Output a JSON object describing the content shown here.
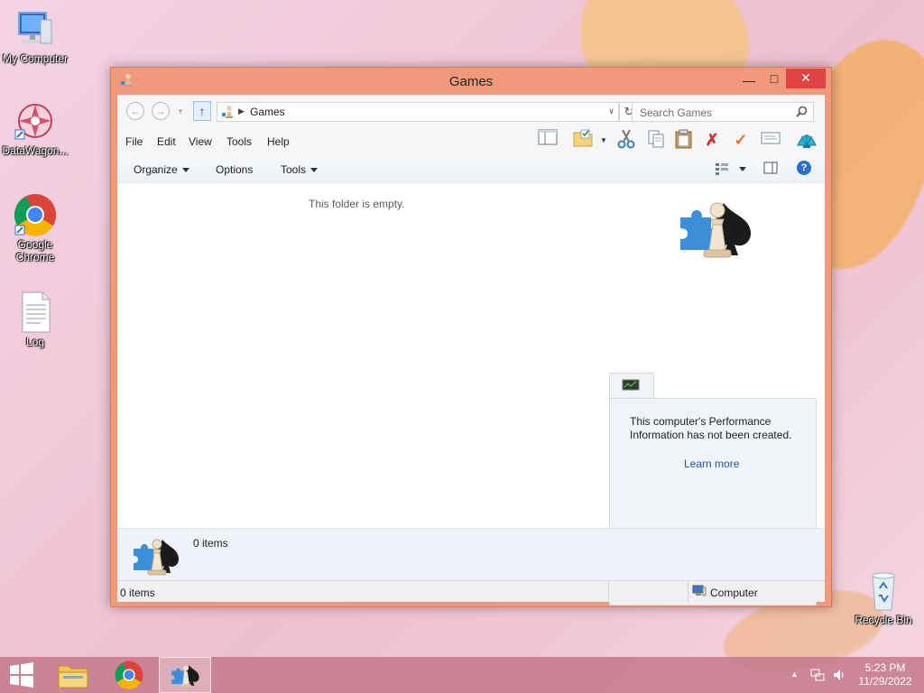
{
  "desktop": {
    "icons": [
      {
        "label": "My Computer"
      },
      {
        "label": "DataWagon..."
      },
      {
        "label": "Google Chrome"
      },
      {
        "label": "Log"
      },
      {
        "label": "Recycle Bin"
      }
    ]
  },
  "window": {
    "title": "Games",
    "address": {
      "current": "Games"
    },
    "search": {
      "placeholder": "Search Games"
    },
    "menu": [
      "File",
      "Edit",
      "View",
      "Tools",
      "Help"
    ],
    "commands": {
      "organize": "Organize",
      "options": "Options",
      "tools": "Tools"
    },
    "content": {
      "empty_message": "This folder is empty."
    },
    "performance_panel": {
      "text": "This computer's Performance Information has not been created.",
      "link": "Learn more"
    },
    "details": {
      "item_count": "0 items"
    },
    "status": {
      "left": "0 items",
      "right": "Computer"
    }
  },
  "taskbar": {
    "time": "5:23 PM",
    "date": "11/29/2022"
  },
  "colors": {
    "window_frame": "#f1997a",
    "link": "#1a5aa6",
    "taskbar": "#c4788c"
  }
}
